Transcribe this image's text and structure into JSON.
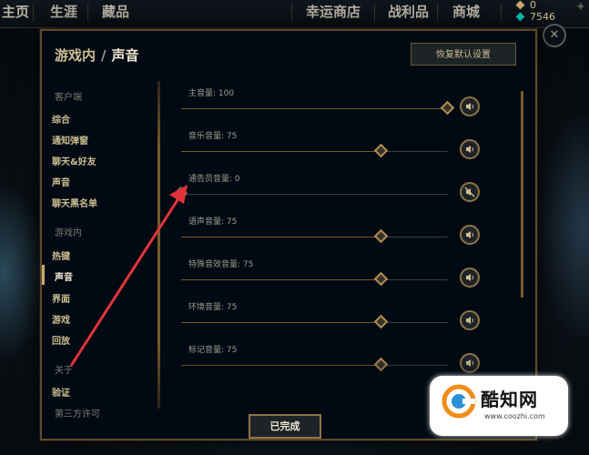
{
  "topbar": {
    "nav": [
      "主页",
      "生涯",
      "藏品",
      "幸运商店",
      "战利品",
      "商城"
    ],
    "currency": [
      {
        "icon": "orange-essence-icon",
        "value": "0",
        "color": "#c8aa6e"
      },
      {
        "icon": "blue-essence-icon",
        "value": "7546",
        "color": "#0ac8b9"
      }
    ],
    "close_icon": "close-icon"
  },
  "dialog": {
    "breadcrumb_parent": "游戏内",
    "breadcrumb_sep": "/",
    "breadcrumb_current": "声音",
    "reset_label": "恢复默认设置",
    "done_label": "已完成"
  },
  "sidebar": {
    "client_header": "客户端",
    "client_items": [
      "综合",
      "通知弹窗",
      "聊天&好友",
      "声音",
      "聊天黑名单"
    ],
    "ingame_header": "游戏内",
    "ingame_items": [
      "热键",
      "声音",
      "界面",
      "游戏",
      "回放"
    ],
    "about_header": "关于",
    "about_items": [
      "验证",
      "第三方许可"
    ],
    "active_item": "声音"
  },
  "sliders": [
    {
      "label": "主音量: 100",
      "value": 100,
      "muted": false
    },
    {
      "label": "音乐音量: 75",
      "value": 75,
      "muted": false
    },
    {
      "label": "通告员音量: 0",
      "value": 0,
      "muted": true
    },
    {
      "label": "语声音量: 75",
      "value": 75,
      "muted": false
    },
    {
      "label": "特殊音效音量: 75",
      "value": 75,
      "muted": false
    },
    {
      "label": "环境音量: 75",
      "value": 75,
      "muted": false
    },
    {
      "label": "标记音量: 75",
      "value": 75,
      "muted": false
    }
  ],
  "colors": {
    "gold": "#c8aa6e",
    "annotation": "#e0343a"
  },
  "watermark": {
    "name": "酷知网",
    "url": "www.coozhi.com"
  }
}
